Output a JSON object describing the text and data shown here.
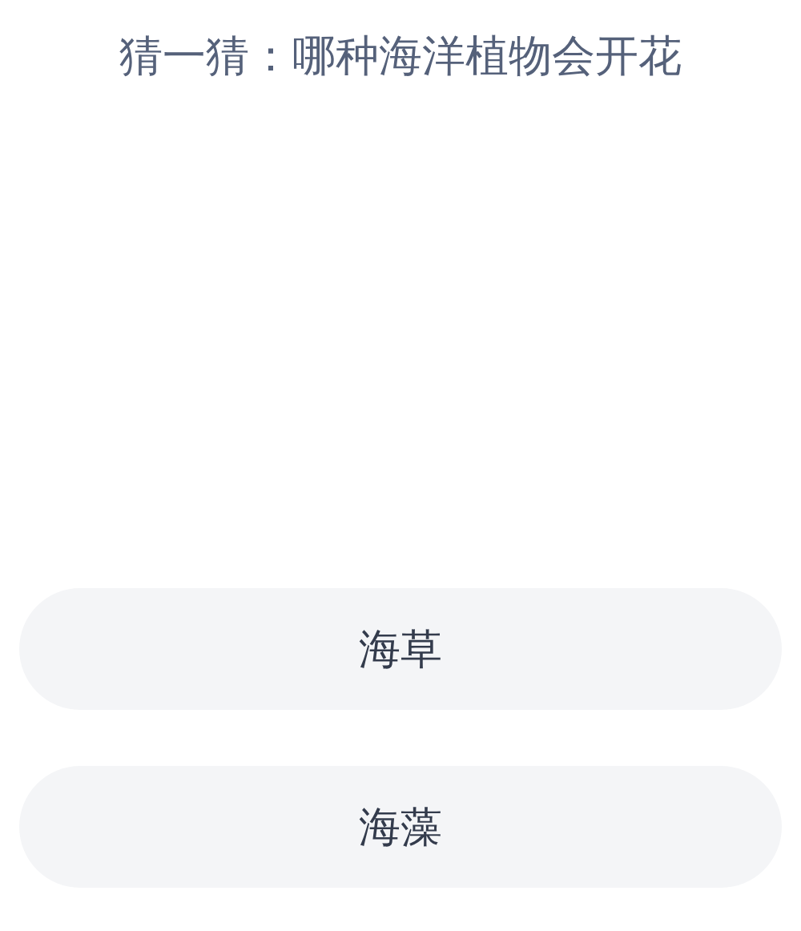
{
  "question": "猜一猜：哪种海洋植物会开花",
  "options": [
    {
      "label": "海草"
    },
    {
      "label": "海藻"
    }
  ]
}
